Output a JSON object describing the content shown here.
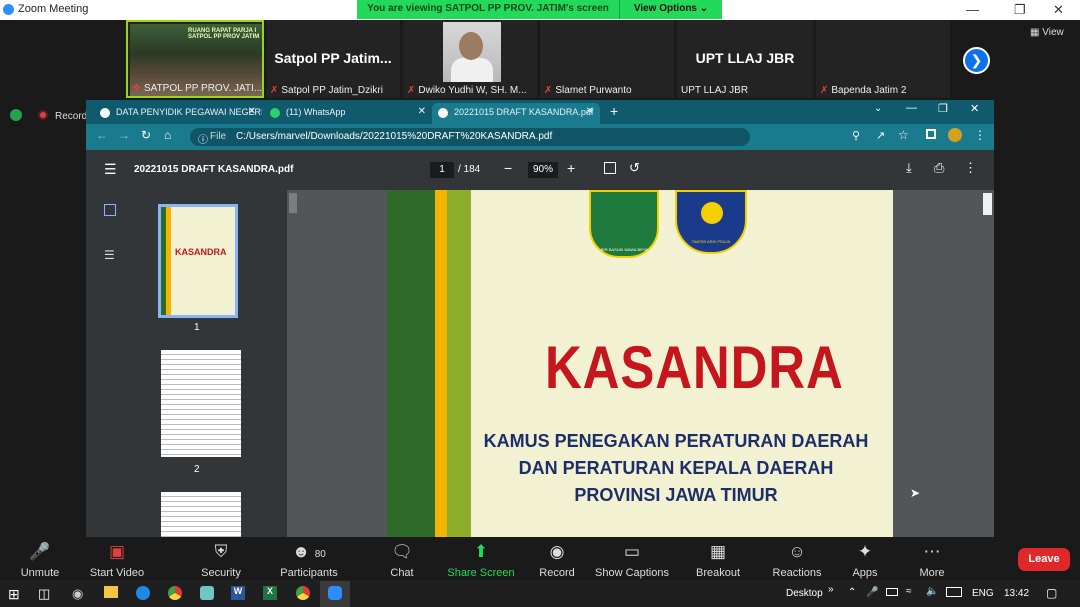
{
  "zoom": {
    "window_title": "Zoom Meeting",
    "banner_text": "You are viewing SATPOL PP PROV. JATIM's screen",
    "view_options_label": "View Options",
    "view_label": "View",
    "recording_label": "Recording",
    "participants": [
      {
        "big": "",
        "name": "SATPOL PP PROV. JATI..."
      },
      {
        "big": "Satpol PP Jatim...",
        "name": "Satpol PP Jatim_Dzikri"
      },
      {
        "big": "",
        "name": "Dwiko Yudhi W, SH. M..."
      },
      {
        "big": "",
        "name": "Slamet Purwanto"
      },
      {
        "big": "UPT LLAJ JBR",
        "name": "UPT LLAJ JBR"
      },
      {
        "big": "",
        "name": "Bapenda Jatim 2"
      }
    ],
    "tile1_banner": "RUANG RAPAT PARJA I SATPOL PP PROV JATIM",
    "toolbar": {
      "unmute": "Unmute",
      "start_video": "Start Video",
      "security": "Security",
      "participants": "Participants",
      "participant_count": "80",
      "chat": "Chat",
      "share_screen": "Share Screen",
      "record": "Record",
      "show_captions": "Show Captions",
      "breakout_rooms": "Breakout Rooms",
      "reactions": "Reactions",
      "apps": "Apps",
      "more": "More",
      "leave": "Leave"
    }
  },
  "browser": {
    "tabs": [
      {
        "label": "DATA PENYIDIK PEGAWAI NEGERI",
        "active": false
      },
      {
        "label": "(11) WhatsApp",
        "active": false
      },
      {
        "label": "20221015 DRAFT KASANDRA.pdf",
        "active": true
      }
    ],
    "url_prefix": "File",
    "url": "C:/Users/marvel/Downloads/20221015%20DRAFT%20KASANDRA.pdf"
  },
  "pdf": {
    "filename": "20221015 DRAFT KASANDRA.pdf",
    "page_current": "1",
    "page_total": "/ 184",
    "zoom": "90%",
    "thumb_labels": [
      "1",
      "2"
    ],
    "thumb1_title": "KASANDRA",
    "cover_title": "KASANDRA",
    "cover_subtitle_lines": [
      "KAMUS PENEGAKAN PERATURAN DAERAH",
      "DAN PERATURAN KEPALA DAERAH",
      "PROVINSI JAWA TIMUR"
    ],
    "logo1_motto": "JER BASUKI MAWA BEYA",
    "logo2_motto": "TAMTIB ARIK PRAJA"
  },
  "taskbar": {
    "desktop_label": "Desktop",
    "lang": "ENG",
    "time": "13:42"
  },
  "colors": {
    "zoom_green": "#23d959",
    "browser_teal": "#105a6e",
    "leave_red": "#e02828",
    "kasandra_red": "#c4161c"
  }
}
